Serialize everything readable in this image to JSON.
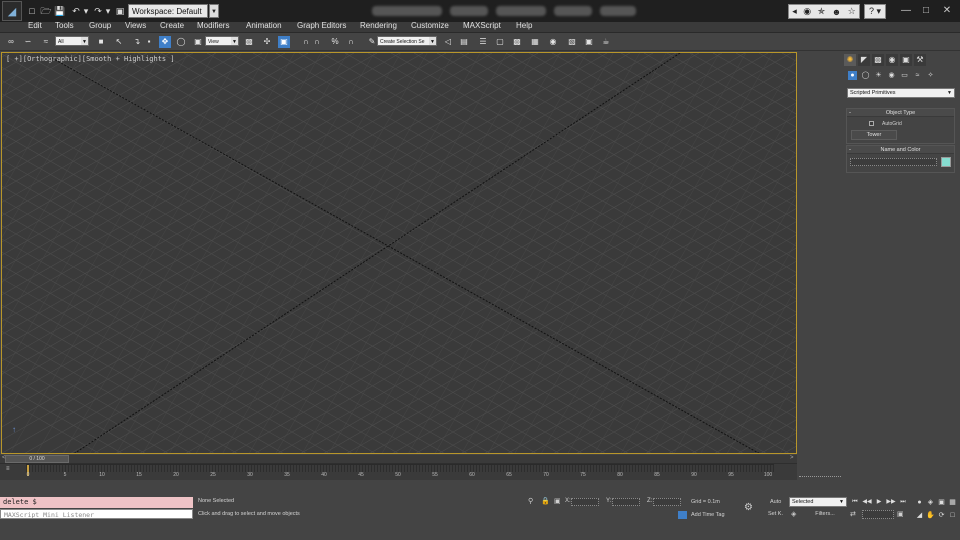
{
  "titlebar": {
    "workspace_label": "Workspace: Default",
    "logo_icon": "3ds-max-logo-icon",
    "quick_access_icons": [
      "new-scene-icon",
      "open-file-icon",
      "save-file-icon",
      "undo-icon",
      "redo-icon",
      "project-folder-icon"
    ],
    "title_tools_icons": [
      "infocenter-arrow-icon",
      "binoculars-icon",
      "key-icon",
      "user-icon",
      "star-icon"
    ],
    "help_icon": "help-icon"
  },
  "menu": {
    "items": [
      "Edit",
      "Tools",
      "Group",
      "Views",
      "Create",
      "Modifiers",
      "Animation",
      "Graph Editors",
      "Rendering",
      "Customize",
      "MAXScript",
      "Help"
    ]
  },
  "toolbar": {
    "selection_filter": "All",
    "reference_coord": "View",
    "named_selection": "Create Selection Se"
  },
  "viewport": {
    "label": "[ +][Orthographic][Smooth + Highlights ]",
    "border_color": "#b8962a",
    "grid_color": "#4c4c4c"
  },
  "command_panel": {
    "category": "Scripted Primitives",
    "object_type_title": "Object Type",
    "autogrid_label": "AutoGrid",
    "tower_button": "Tower",
    "name_color_title": "Name and Color",
    "swatch_color": "#86ddd0"
  },
  "timeline": {
    "frame_display": "0 / 100",
    "ticks": [
      "0",
      "5",
      "10",
      "15",
      "20",
      "25",
      "30",
      "35",
      "40",
      "45",
      "50",
      "55",
      "60",
      "65",
      "70",
      "75",
      "80",
      "85",
      "90",
      "95",
      "100"
    ]
  },
  "status": {
    "maxscript_input": "delete $",
    "maxscript_output": "MAXScript Mini Listener",
    "selection_text": "None Selected",
    "prompt_text": "Click and drag to select and move objects",
    "x_label": "X:",
    "y_label": "Y:",
    "z_label": "Z:",
    "grid_text": "Grid = 0.1m",
    "time_tag_text": "Add Time Tag",
    "auto_key_label": "Auto",
    "set_key_label": "Set K.",
    "key_filter_value": "Selected",
    "filters_label": "Filters..."
  }
}
